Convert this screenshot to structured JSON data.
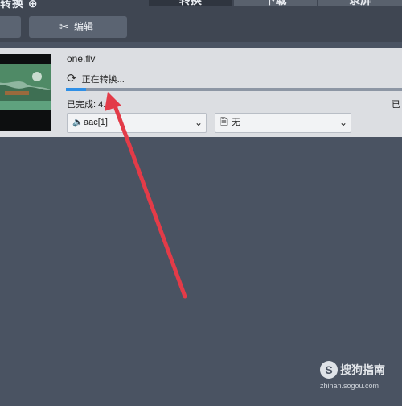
{
  "top_tabs": [
    {
      "label": "转换",
      "active": true
    },
    {
      "label": "下载",
      "active": false
    },
    {
      "label": "录屏",
      "active": false
    }
  ],
  "title_fragment": "转换 ⊕",
  "toolbar": {
    "edit_label": "编辑"
  },
  "item": {
    "filename": "one.flv",
    "status_text": "正在转换...",
    "progress": 0.06,
    "completed_label": "已完成: 4.",
    "completed_right": "已",
    "audio_select": {
      "icon": "speaker-icon",
      "value": "aac[1]"
    },
    "subtitle_select": {
      "icon": "document-icon",
      "value": "无"
    }
  },
  "watermark": {
    "logo": "S",
    "text": "搜狗指南",
    "url": "zhinan.sogou.com"
  },
  "colors": {
    "background": "#4a5362",
    "accent": "#2f8fe6",
    "arrow": "#e33b48"
  }
}
